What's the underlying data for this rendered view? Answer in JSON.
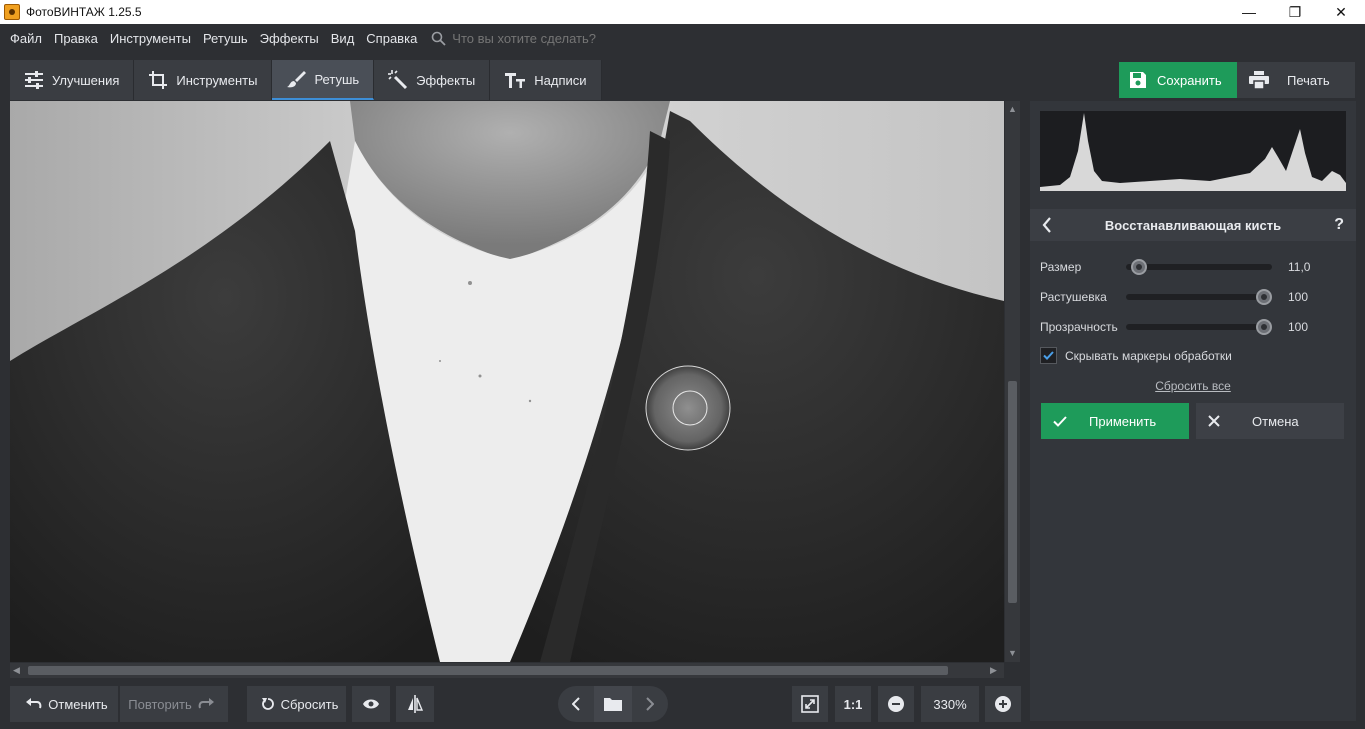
{
  "window": {
    "title": "ФотоВИНТАЖ 1.25.5",
    "minimize": "—",
    "restore": "❐",
    "close": "✕"
  },
  "menu": {
    "items": [
      "Файл",
      "Правка",
      "Инструменты",
      "Ретушь",
      "Эффекты",
      "Вид",
      "Справка"
    ],
    "search_placeholder": "Что вы хотите сделать?"
  },
  "tabs": [
    {
      "label": "Улучшения",
      "icon": "sliders-icon"
    },
    {
      "label": "Инструменты",
      "icon": "crop-icon"
    },
    {
      "label": "Ретушь",
      "icon": "brush-icon",
      "active": true
    },
    {
      "label": "Эффекты",
      "icon": "magic-wand-icon"
    },
    {
      "label": "Надписи",
      "icon": "text-icon"
    }
  ],
  "actions": {
    "save": "Сохранить",
    "print": "Печать"
  },
  "panel": {
    "tool_title": "Восстанавливающая кисть",
    "help": "?",
    "sliders": [
      {
        "label": "Размер",
        "value": "11,0",
        "fraction": 0.08
      },
      {
        "label": "Растушевка",
        "value": "100",
        "fraction": 1.0
      },
      {
        "label": "Прозрачность",
        "value": "100",
        "fraction": 1.0
      }
    ],
    "hide_markers": {
      "label": "Скрывать маркеры обработки",
      "checked": true
    },
    "reset_all": "Сбросить все",
    "apply": "Применить",
    "cancel": "Отмена"
  },
  "bottom": {
    "undo": "Отменить",
    "redo": "Повторить",
    "reset": "Сбросить",
    "ratio": "1:1",
    "zoom": "330%"
  }
}
